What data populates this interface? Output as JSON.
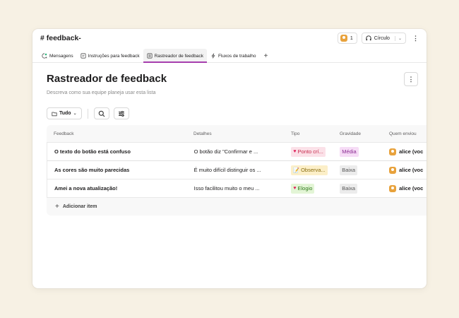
{
  "channel": {
    "title": "# feedback-"
  },
  "header": {
    "member_count": "1",
    "huddle_label": "Círculo",
    "more_icon": "⋮"
  },
  "tabs": [
    {
      "label": "Mensagens",
      "icon": "message-icon"
    },
    {
      "label": "Instruções para feedback",
      "icon": "canvas-icon"
    },
    {
      "label": "Rastreador de feedback",
      "icon": "list-icon"
    },
    {
      "label": "Fluxos de trabalho",
      "icon": "workflow-icon"
    }
  ],
  "page": {
    "title": "Rastreador de feedback",
    "description": "Descreva como sua equipe planeja usar esta lista",
    "filter_label": "Tudo"
  },
  "table": {
    "columns": [
      "Feedback",
      "Detalhes",
      "Tipo",
      "Gravidade",
      "Quem enviou"
    ],
    "rows": [
      {
        "feedback": "O texto do botão está confuso",
        "details": "O botão diz \"Confirmar e ...",
        "type": "Ponto crí...",
        "type_icon": "heart-icon",
        "severity": "Média",
        "sender": "alice (voc"
      },
      {
        "feedback": "As cores são muito parecidas",
        "details": "É muito difícil distinguir os ...",
        "type": "Observa...",
        "type_icon": "memo-icon",
        "severity": "Baixa",
        "sender": "alice (voc"
      },
      {
        "feedback": "Amei a nova atualização!",
        "details": "Isso facilitou muito o meu ...",
        "type": "Elogio",
        "type_icon": "heart-icon",
        "severity": "Baixa",
        "sender": "alice (voc"
      }
    ],
    "add_item_label": "Adicionar item"
  },
  "colors": {
    "accent": "#a73eae",
    "background": "#f7f1e4"
  }
}
